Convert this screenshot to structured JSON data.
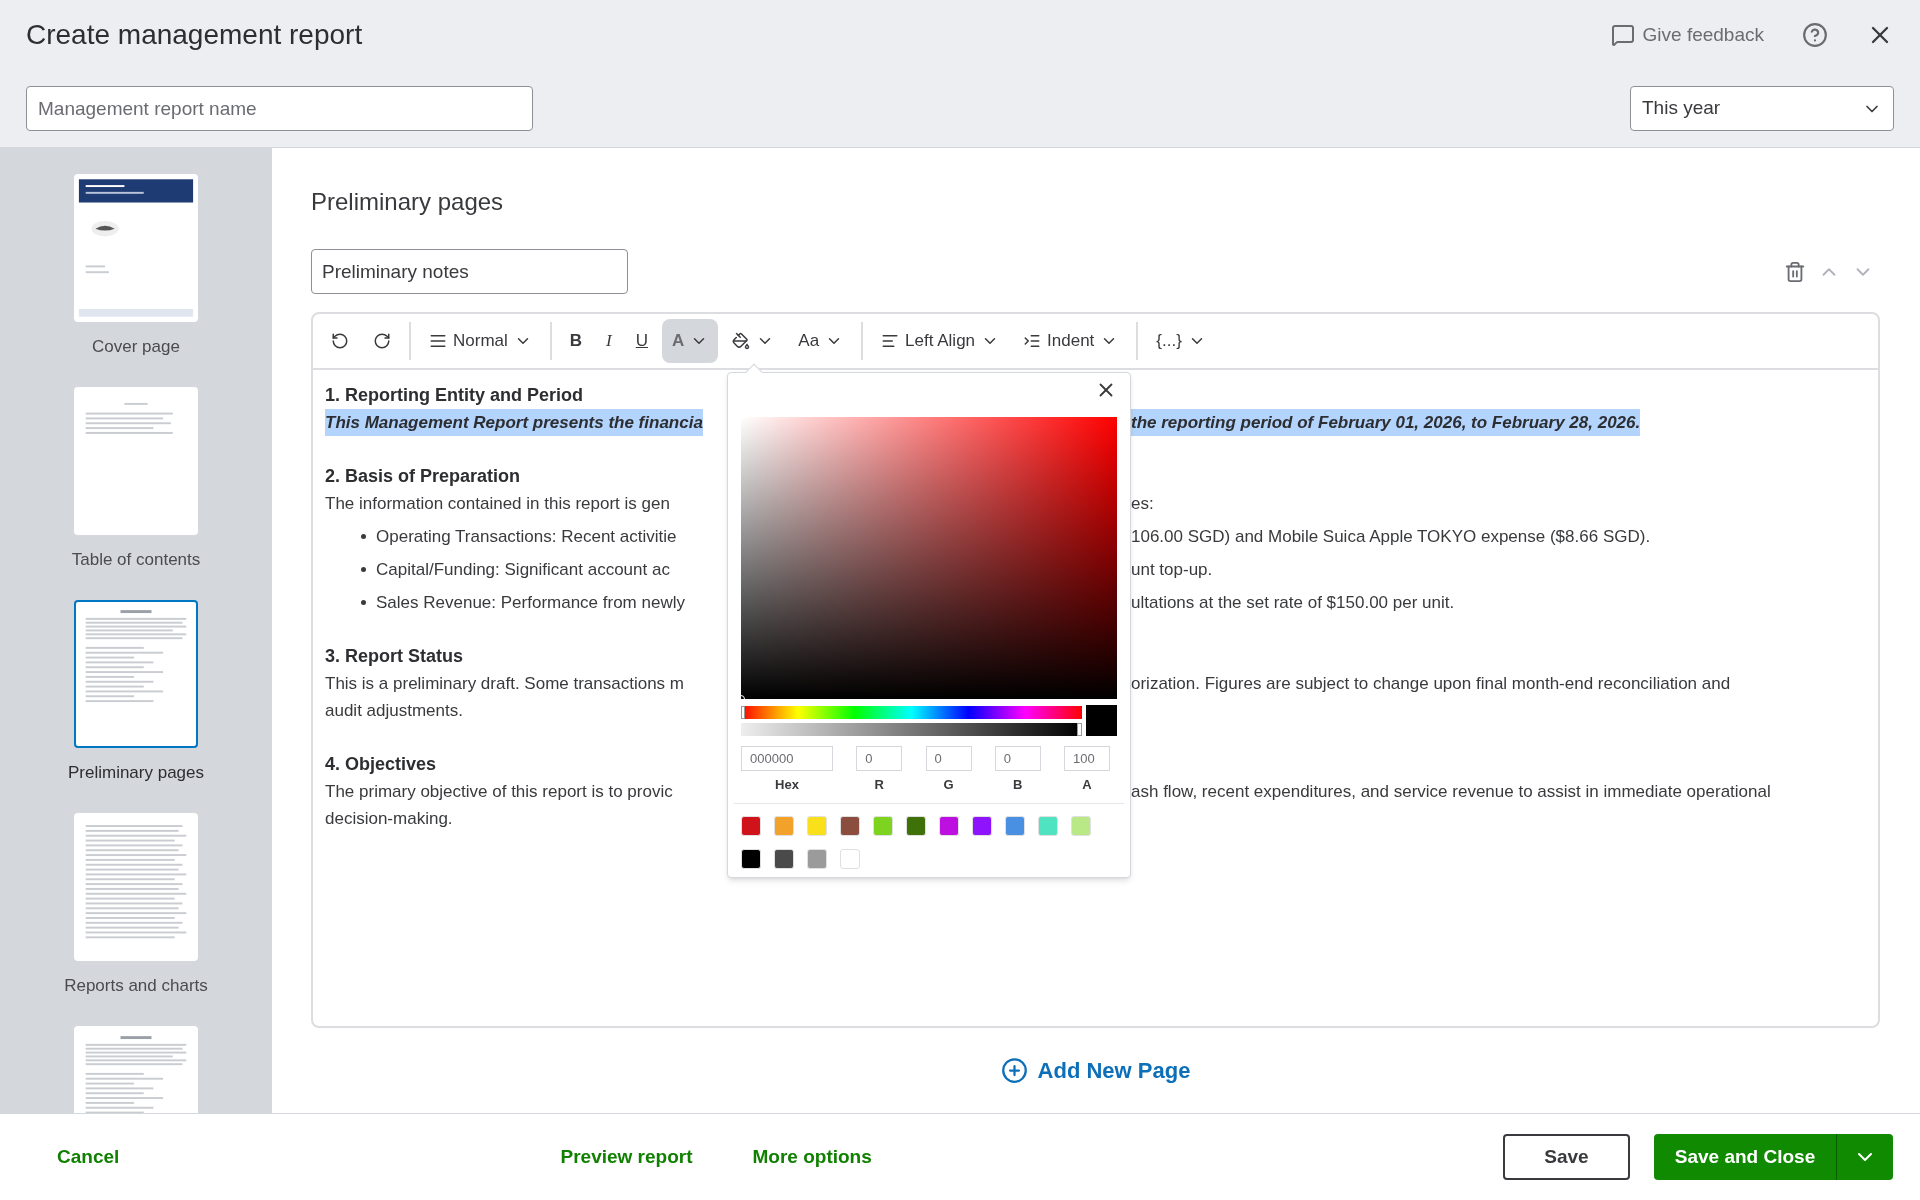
{
  "window": {
    "title": "Create management report",
    "feedback": "Give feedback"
  },
  "report_name": {
    "placeholder": "Management report name"
  },
  "period": {
    "value": "This year"
  },
  "sidebar": {
    "items": [
      {
        "label": "Cover page",
        "kind": "cover",
        "selected": false
      },
      {
        "label": "Table of contents",
        "kind": "toc",
        "selected": false
      },
      {
        "label": "Preliminary pages",
        "kind": "text",
        "selected": true
      },
      {
        "label": "Reports and charts",
        "kind": "report",
        "selected": false
      },
      {
        "kind": "text",
        "selected": false
      }
    ]
  },
  "section": {
    "title": "Preliminary pages",
    "page_name": "Preliminary notes"
  },
  "toolbar": [
    {
      "kind": "undo",
      "dropdown": false,
      "selected": false
    },
    {
      "kind": "redo",
      "dropdown": false,
      "selected": false
    },
    {
      "kind": "paragraph",
      "label": "Normal",
      "dropdown": true,
      "selected": false
    },
    {
      "kind": "bold",
      "label": "B",
      "dropdown": false,
      "selected": false
    },
    {
      "kind": "italic",
      "label": "I",
      "dropdown": false,
      "selected": false
    },
    {
      "kind": "underline",
      "label": "U",
      "dropdown": false,
      "selected": false
    },
    {
      "kind": "color",
      "label": "A",
      "dropdown": true,
      "selected": true
    },
    {
      "kind": "highlight",
      "dropdown": true,
      "selected": false
    },
    {
      "kind": "size",
      "label": "Aa",
      "dropdown": true,
      "selected": false
    },
    {
      "kind": "align",
      "label": "Left Align",
      "dropdown": true,
      "selected": false
    },
    {
      "kind": "indent",
      "label": "Indent",
      "dropdown": true,
      "selected": false
    },
    {
      "kind": "field",
      "label": "{...}",
      "dropdown": true,
      "selected": false
    }
  ],
  "editor": {
    "lines": [
      {
        "kind": "heading",
        "left": "1. Reporting Entity and Period",
        "highlighted": false
      },
      {
        "kind": "emphasis",
        "left": "This Management Report presents the financia",
        "right": "the reporting period of February 01, 2026, to February 28, 2026.",
        "highlighted": true
      },
      {
        "kind": "heading",
        "left": "2. Basis of Preparation",
        "highlighted": false
      },
      {
        "kind": "paragraph",
        "left": "The information contained in this report is gen",
        "right": "es:",
        "highlighted": false
      },
      {
        "kind": "bullet",
        "left": "Operating Transactions: Recent activitie",
        "right": "106.00 SGD) and Mobile Suica Apple TOKYO expense ($8.66 SGD).",
        "highlighted": false
      },
      {
        "kind": "bullet",
        "left": "Capital/Funding: Significant account ac",
        "right": "unt top-up.",
        "highlighted": false
      },
      {
        "kind": "bullet",
        "left": "Sales Revenue: Performance from newly",
        "right": "ultations at the set rate of $150.00 per unit.",
        "highlighted": false
      },
      {
        "kind": "heading",
        "left": "3. Report Status",
        "highlighted": false
      },
      {
        "kind": "paragraph",
        "left": "This is a preliminary draft. Some transactions m",
        "right": "orization. Figures are subject to change upon final month-end reconciliation and",
        "highlighted": false
      },
      {
        "kind": "paragraph",
        "left": "audit adjustments.",
        "highlighted": false
      },
      {
        "kind": "heading",
        "left": "4. Objectives",
        "highlighted": false
      },
      {
        "kind": "paragraph",
        "left": "The primary objective of this report is to provic",
        "right": "ash flow, recent expenditures, and service revenue to assist in immediate operational",
        "highlighted": false
      },
      {
        "kind": "paragraph",
        "left": "decision-making.",
        "highlighted": false
      }
    ]
  },
  "color_picker": {
    "hue": {
      "level": 0
    },
    "alpha": {
      "level": 1
    },
    "fields": [
      {
        "label": "Hex",
        "value": "000000"
      },
      {
        "label": "R",
        "value": "0"
      },
      {
        "label": "G",
        "value": "0"
      },
      {
        "label": "B",
        "value": "0"
      },
      {
        "label": "A",
        "value": "100"
      }
    ],
    "swatches": [
      {
        "color": "#d0121b"
      },
      {
        "color": "#f2a12a"
      },
      {
        "color": "#f9e01a"
      },
      {
        "color": "#8b4e3e"
      },
      {
        "color": "#7ed321"
      },
      {
        "color": "#3e7209"
      },
      {
        "color": "#bd10e0"
      },
      {
        "color": "#9013fe"
      },
      {
        "color": "#4a90e2"
      },
      {
        "color": "#50e3c2"
      },
      {
        "color": "#b8e986"
      },
      {
        "color": "#000000"
      },
      {
        "color": "#4a4a4a"
      },
      {
        "color": "#9b9b9b"
      },
      {
        "color": "#ffffff"
      }
    ]
  },
  "add_page": "Add New Page",
  "footer": {
    "cancel": "Cancel",
    "preview": "Preview report",
    "more": "More options",
    "save": "Save",
    "save_close": "Save and Close"
  }
}
